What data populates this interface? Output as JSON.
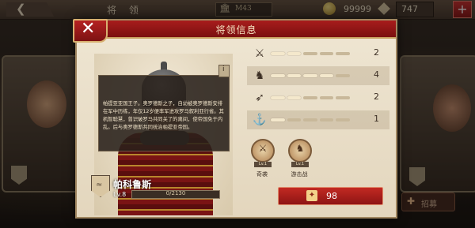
{
  "topbar": {
    "title": "将 领",
    "bank_value": "M43",
    "coins": "99999",
    "gems": "747",
    "plus_label": "+"
  },
  "side": {
    "recruit_label": "招募"
  },
  "dialog": {
    "title": "将领信息",
    "close_label": "✕",
    "bio": "帕提亚亚国王子。奥罗德斯之子，自幼被奥罗德斯安排在军中历练，年仅12岁便率军进攻罗马叙利亚行省。其机智聪慧，曾识破罗马共同关了的离间，使帝国免于内乱。后与奥罗德斯共同统治帕提亚帝国。",
    "general_name": "帕科鲁斯",
    "level": "Lv.8",
    "xp_text": "0/2130",
    "xp_fraction": 0.0,
    "stats": [
      {
        "icon": "sword-icon",
        "value": "2",
        "level": 2
      },
      {
        "icon": "horse-icon",
        "value": "4",
        "level": 4
      },
      {
        "icon": "bow-icon",
        "value": "2",
        "level": 2
      },
      {
        "icon": "anchor-icon",
        "value": "1",
        "level": 1
      }
    ],
    "skills": [
      {
        "name": "奇袭",
        "level": "Lv.1"
      },
      {
        "name": "游击战",
        "level": "Lv.1"
      }
    ],
    "buy_value": "98"
  }
}
